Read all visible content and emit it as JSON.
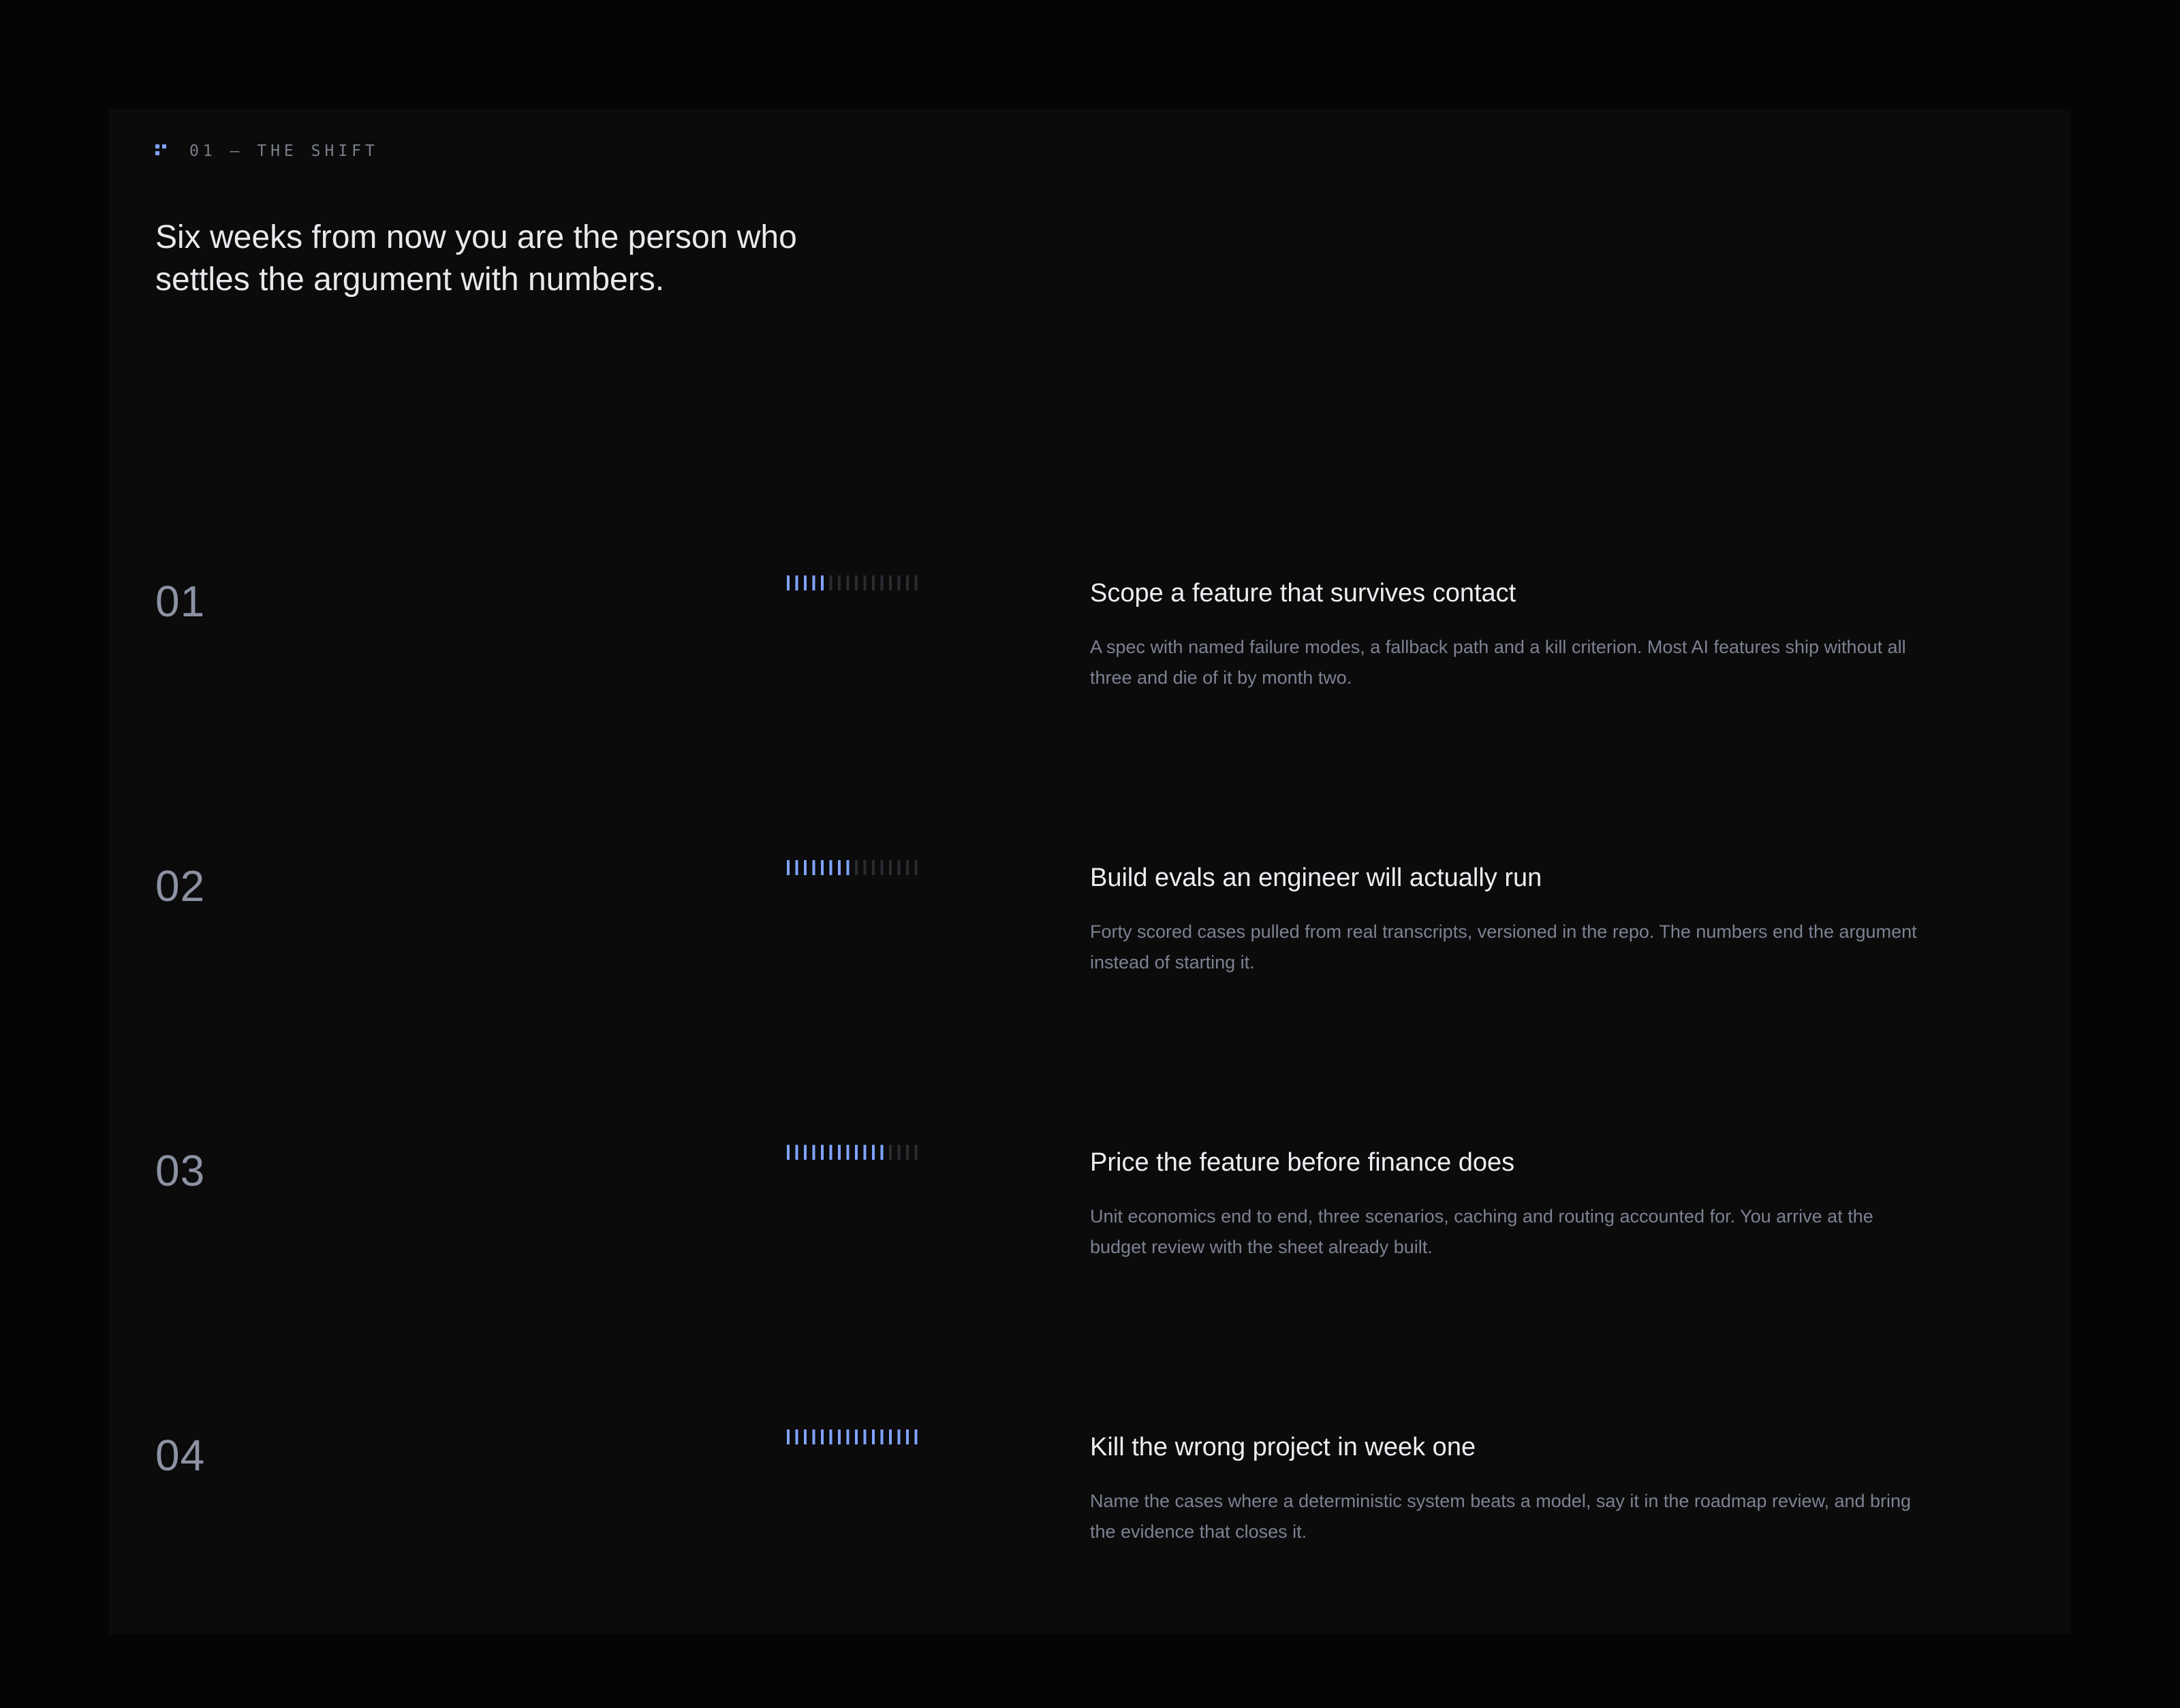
{
  "section": {
    "eyebrow": "01 — THE SHIFT",
    "headline": "Six weeks from now you are the person who settles the argument with numbers."
  },
  "colors": {
    "accent": "#7fa3ff",
    "meter_off": "#2a2c31",
    "title": "#eceef2",
    "body": "#7d8292",
    "number": "#8c92a2"
  },
  "steps": [
    {
      "number": "01",
      "progress": 0.3125,
      "title": "Scope a feature that survives contact",
      "description": "A spec with named failure modes, a fallback path and a kill criterion. Most AI features ship without all three and die of it by month two."
    },
    {
      "number": "02",
      "progress": 0.5,
      "title": "Build evals an engineer will actually run",
      "description": "Forty scored cases pulled from real transcripts, versioned in the repo. The numbers end the argument instead of starting it."
    },
    {
      "number": "03",
      "progress": 0.75,
      "title": "Price the feature before finance does",
      "description": "Unit economics end to end, three scenarios, caching and routing accounted for. You arrive at the budget review with the sheet already built."
    },
    {
      "number": "04",
      "progress": 1.0,
      "title": "Kill the wrong project in week one",
      "description": "Name the cases where a deterministic system beats a model, say it in the roadmap review, and bring the evidence that closes it."
    }
  ]
}
